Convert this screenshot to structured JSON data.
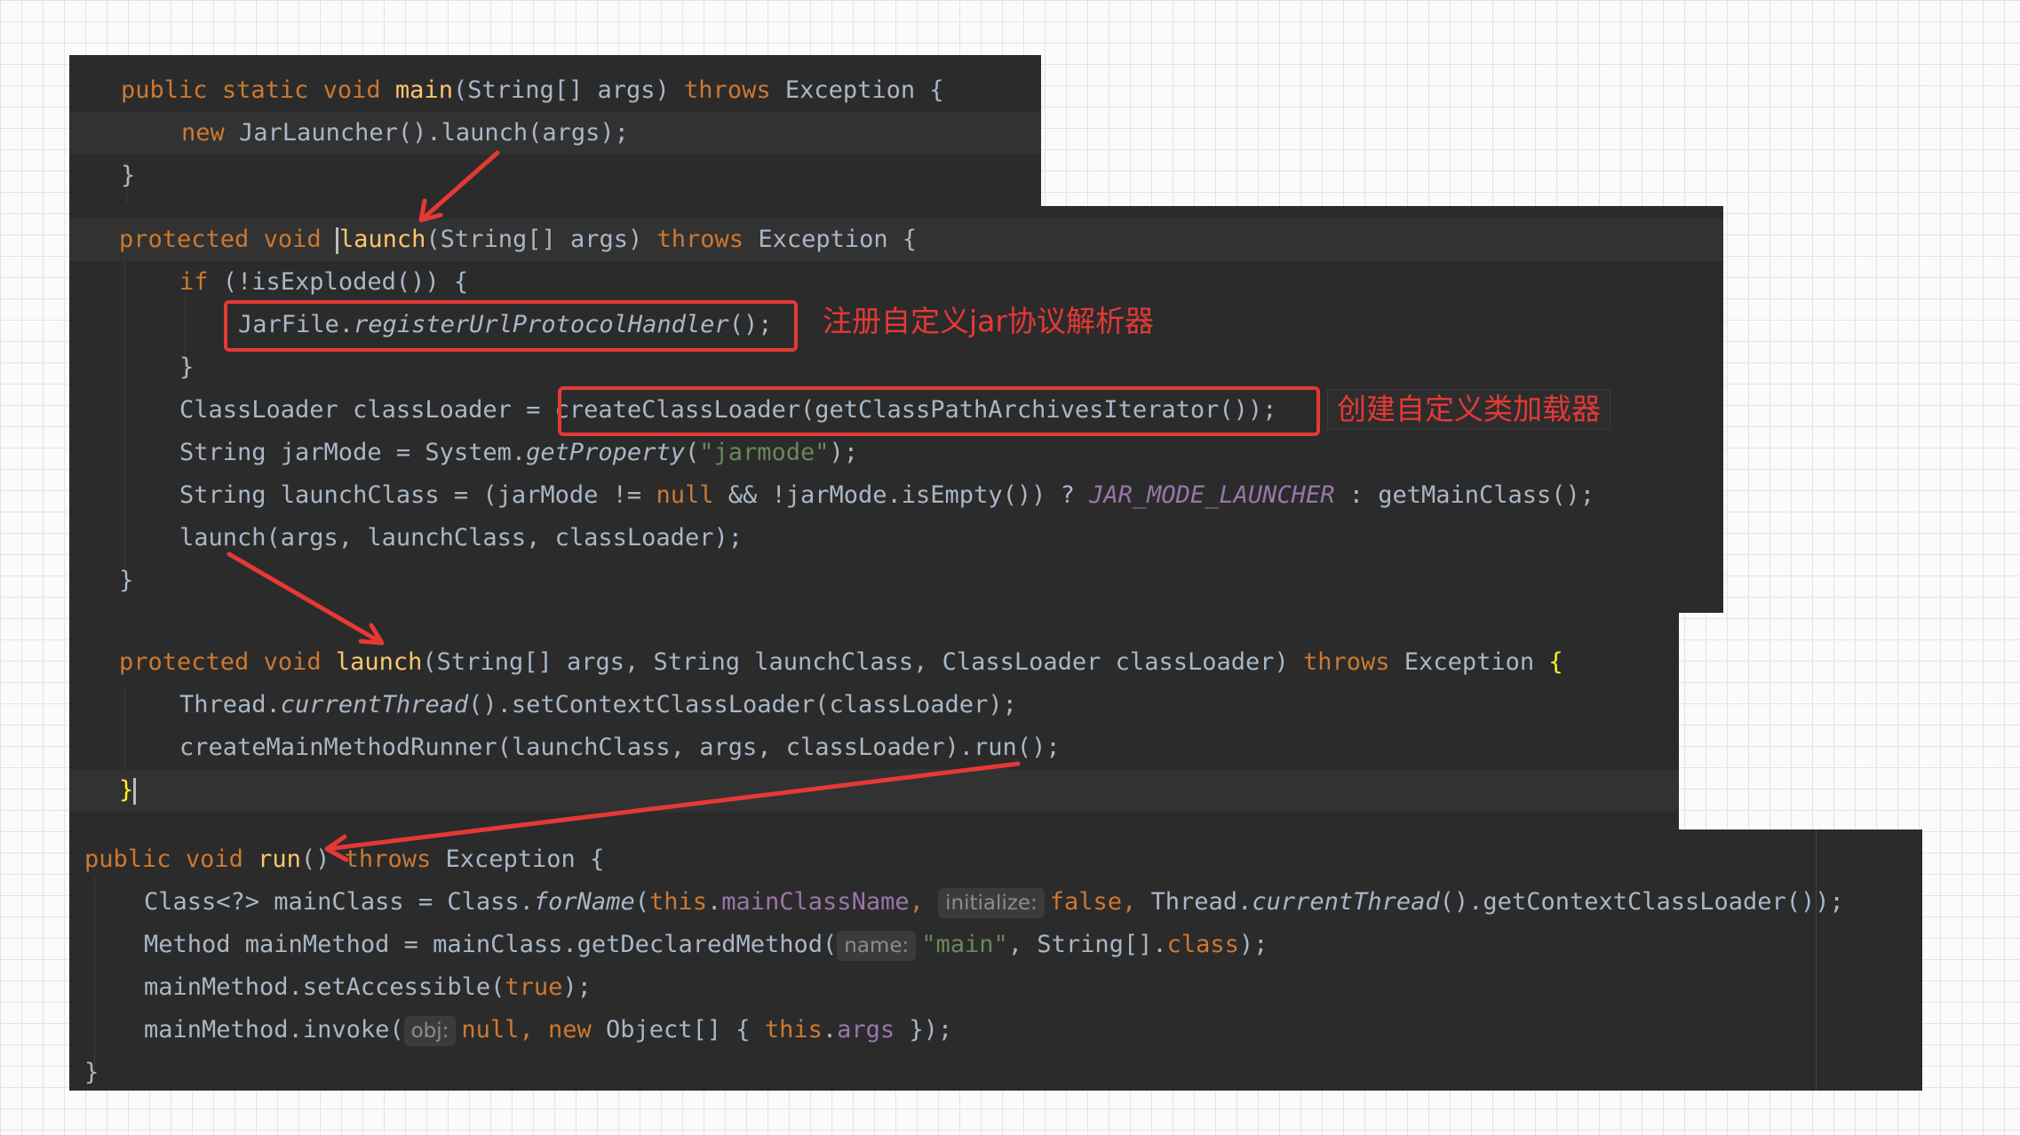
{
  "panel_main": {
    "kw_public": "public",
    "kw_static": "static",
    "kw_void": "void",
    "method": "main",
    "params_open": "(String[] args) ",
    "kw_throws": "throws",
    "exception_tail": " Exception {",
    "kw_new": "new",
    "call_body": " JarLauncher().launch(args);",
    "close_brace": "}"
  },
  "panel_launch1": {
    "kw_protected": "protected",
    "kw_void": "void",
    "method": "launch",
    "params": "(String[] args) ",
    "kw_throws": "throws",
    "exception_tail": " Exception {",
    "kw_if": "if",
    "if_cond": " (!isExploded()) {",
    "register_class": "JarFile.",
    "register_method": "registerUrlProtocolHandler",
    "register_tail": "();",
    "if_close": "}",
    "classloader_decl": "ClassLoader classLoader = ",
    "create_classloader_call": "createClassLoader(getClassPathArchivesIterator());",
    "jarmode_decl": "String jarMode = System.",
    "get_property": "getProperty",
    "jarmode_open": "(",
    "jarmode_str": "\"jarmode\"",
    "jarmode_close": ");",
    "launchclass_decl": "String launchClass = (jarMode != ",
    "kw_null": "null",
    "launchclass_mid": " && !jarMode.isEmpty()) ? ",
    "jar_mode_launcher": "JAR_MODE_LAUNCHER",
    "launchclass_tail": " : getMainClass();",
    "launch_call": "launch(args, launchClass, classLoader);",
    "close_brace": "}"
  },
  "panel_launch2": {
    "kw_protected": "protected",
    "kw_void": "void",
    "method": "launch",
    "params": "(String[] args, String launchClass, ClassLoader classLoader) ",
    "kw_throws": "throws",
    "exception_tail": " Exception ",
    "open_brace": "{",
    "thread_class": "Thread.",
    "current_thread": "currentThread",
    "set_ctx_loader": "().setContextClassLoader(classLoader);",
    "runner_call": "createMainMethodRunner(launchClass, args, classLoader).run();",
    "close_brace": "}"
  },
  "panel_run": {
    "kw_public": "public",
    "kw_void": "void",
    "method": "run",
    "params": "() ",
    "kw_throws": "throws",
    "exception_tail": " Exception {",
    "mainclass_decl": "Class<?> mainClass = Class.",
    "for_name": "forName",
    "paren_open": "(",
    "kw_this": "this",
    "dot": ".",
    "field_main_class_name": "mainClassName",
    "comma": ", ",
    "hint_initialize": "initialize:",
    "kw_false": "false",
    "thread_tail_a": "Thread.",
    "current_thread": "currentThread",
    "thread_tail_b": "().getContextClassLoader());",
    "mainmethod_decl": "Method mainMethod = mainClass.getDeclaredMethod(",
    "hint_name": "name:",
    "main_str": "\"main\"",
    "string_array": ", String[].",
    "kw_class": "class",
    "semicolon_close": ");",
    "set_accessible_open": "mainMethod.setAccessible(",
    "kw_true": "true",
    "invoke_open": "mainMethod.invoke(",
    "hint_obj": "obj:",
    "kw_null": "null",
    "object_array": " Object[] { ",
    "field_args": "args",
    "invoke_close": " });",
    "close_brace": "}"
  },
  "annotations": {
    "register_note": "注册自定义jar协议解析器",
    "classloader_note": "创建自定义类加载器"
  },
  "colors": {
    "editor_bg": "#2b2b2b",
    "keyword": "#cc7832",
    "method_decl": "#ffc66d",
    "string": "#6a8759",
    "field": "#9876aa",
    "annotation_red": "#e53935"
  }
}
